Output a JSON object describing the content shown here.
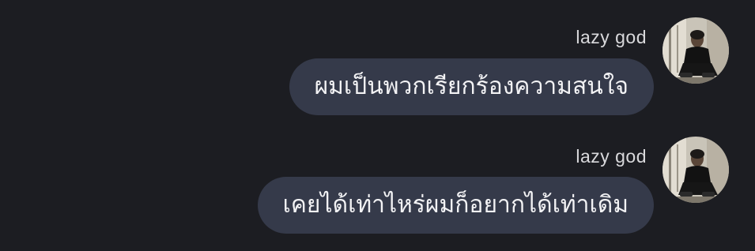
{
  "messages": [
    {
      "sender": "lazy god",
      "text": "ผมเป็นพวกเรียกร้องความสนใจ",
      "avatar_icon": "user-avatar-photo"
    },
    {
      "sender": "lazy god",
      "text": "เคยได้เท่าไหร่ผมก็อยากได้เท่าเดิม",
      "avatar_icon": "user-avatar-photo"
    }
  ],
  "colors": {
    "background": "#1c1d22",
    "bubble": "#353a4a",
    "text": "#f2f2f4",
    "sender": "#d9d9dc"
  }
}
